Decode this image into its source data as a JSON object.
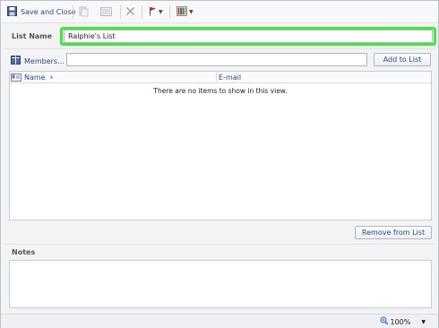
{
  "toolbar": {
    "save_close_label": "Save and Close"
  },
  "form": {
    "list_name_label": "List Name",
    "list_name_value": "Ralphie's List",
    "members_label": "Members...",
    "members_value": "",
    "add_button": "Add to List",
    "remove_button": "Remove from List",
    "notes_label": "Notes",
    "notes_value": ""
  },
  "table": {
    "columns": [
      "Name",
      "E-mail"
    ],
    "empty_message": "There are no items to show in this view."
  },
  "status": {
    "zoom": "100%"
  },
  "colors": {
    "accent": "#2a4a80",
    "highlight": "#44e53d"
  }
}
